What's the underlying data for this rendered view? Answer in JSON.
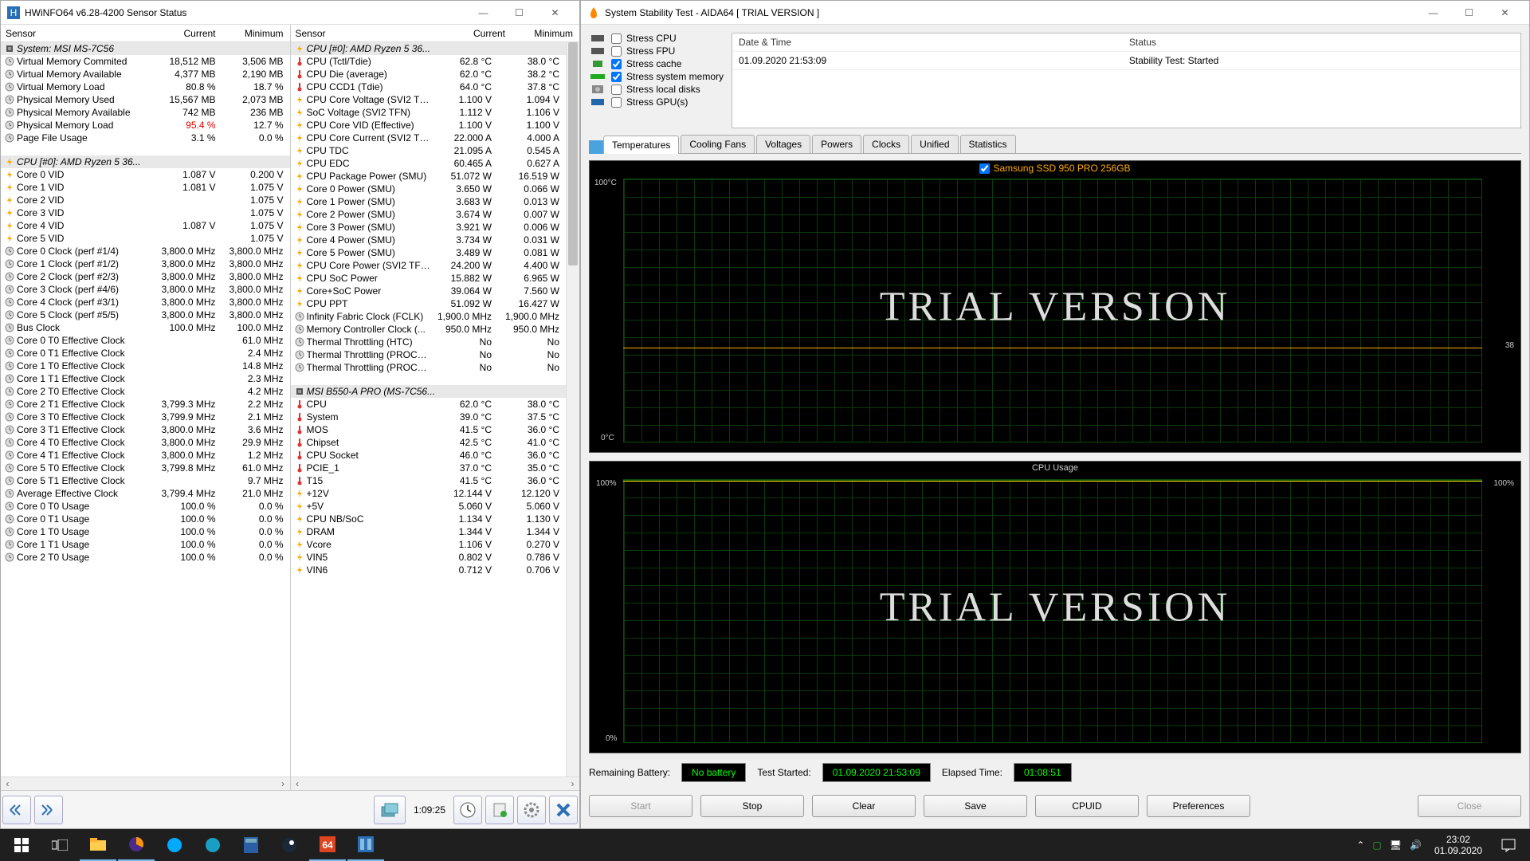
{
  "hwinfo": {
    "title": "HWiNFO64 v6.28-4200 Sensor Status",
    "columns": {
      "name": "Sensor",
      "current": "Current",
      "minimum": "Minimum"
    },
    "panel1_rows": [
      {
        "type": "group",
        "icon": "chip",
        "name": "System: MSI MS-7C56"
      },
      {
        "icon": "clock",
        "name": "Virtual Memory Commited",
        "cur": "18,512 MB",
        "min": "3,506 MB"
      },
      {
        "icon": "clock",
        "name": "Virtual Memory Available",
        "cur": "4,377 MB",
        "min": "2,190 MB"
      },
      {
        "icon": "clock",
        "name": "Virtual Memory Load",
        "cur": "80.8 %",
        "min": "18.7 %"
      },
      {
        "icon": "clock",
        "name": "Physical Memory Used",
        "cur": "15,567 MB",
        "min": "2,073 MB"
      },
      {
        "icon": "clock",
        "name": "Physical Memory Available",
        "cur": "742 MB",
        "min": "236 MB"
      },
      {
        "icon": "clock",
        "name": "Physical Memory Load",
        "cur": "95.4 %",
        "min": "12.7 %",
        "curclass": "red"
      },
      {
        "icon": "clock",
        "name": "Page File Usage",
        "cur": "3.1 %",
        "min": "0.0 %"
      },
      {
        "type": "spacer"
      },
      {
        "type": "group",
        "icon": "bolt",
        "name": "CPU [#0]: AMD Ryzen 5 36..."
      },
      {
        "icon": "bolt",
        "name": "Core 0 VID",
        "cur": "1.087 V",
        "min": "0.200 V"
      },
      {
        "icon": "bolt",
        "name": "Core 1 VID",
        "cur": "1.081 V",
        "min": "1.075 V"
      },
      {
        "icon": "bolt",
        "name": "Core 2 VID",
        "cur": "",
        "min": "1.075 V"
      },
      {
        "icon": "bolt",
        "name": "Core 3 VID",
        "cur": "",
        "min": "1.075 V"
      },
      {
        "icon": "bolt",
        "name": "Core 4 VID",
        "cur": "1.087 V",
        "min": "1.075 V"
      },
      {
        "icon": "bolt",
        "name": "Core 5 VID",
        "cur": "",
        "min": "1.075 V"
      },
      {
        "icon": "clock",
        "name": "Core 0 Clock (perf #1/4)",
        "cur": "3,800.0 MHz",
        "min": "3,800.0 MHz"
      },
      {
        "icon": "clock",
        "name": "Core 1 Clock (perf #1/2)",
        "cur": "3,800.0 MHz",
        "min": "3,800.0 MHz"
      },
      {
        "icon": "clock",
        "name": "Core 2 Clock (perf #2/3)",
        "cur": "3,800.0 MHz",
        "min": "3,800.0 MHz"
      },
      {
        "icon": "clock",
        "name": "Core 3 Clock (perf #4/6)",
        "cur": "3,800.0 MHz",
        "min": "3,800.0 MHz"
      },
      {
        "icon": "clock",
        "name": "Core 4 Clock (perf #3/1)",
        "cur": "3,800.0 MHz",
        "min": "3,800.0 MHz"
      },
      {
        "icon": "clock",
        "name": "Core 5 Clock (perf #5/5)",
        "cur": "3,800.0 MHz",
        "min": "3,800.0 MHz"
      },
      {
        "icon": "clock",
        "name": "Bus Clock",
        "cur": "100.0 MHz",
        "min": "100.0 MHz"
      },
      {
        "icon": "clock",
        "name": "Core 0 T0 Effective Clock",
        "cur": "",
        "min": "61.0 MHz"
      },
      {
        "icon": "clock",
        "name": "Core 0 T1 Effective Clock",
        "cur": "",
        "min": "2.4 MHz"
      },
      {
        "icon": "clock",
        "name": "Core 1 T0 Effective Clock",
        "cur": "",
        "min": "14.8 MHz"
      },
      {
        "icon": "clock",
        "name": "Core 1 T1 Effective Clock",
        "cur": "",
        "min": "2.3 MHz"
      },
      {
        "icon": "clock",
        "name": "Core 2 T0 Effective Clock",
        "cur": "",
        "min": "4.2 MHz"
      },
      {
        "icon": "clock",
        "name": "Core 2 T1 Effective Clock",
        "cur": "3,799.3 MHz",
        "min": "2.2 MHz"
      },
      {
        "icon": "clock",
        "name": "Core 3 T0 Effective Clock",
        "cur": "3,799.9 MHz",
        "min": "2.1 MHz"
      },
      {
        "icon": "clock",
        "name": "Core 3 T1 Effective Clock",
        "cur": "3,800.0 MHz",
        "min": "3.6 MHz"
      },
      {
        "icon": "clock",
        "name": "Core 4 T0 Effective Clock",
        "cur": "3,800.0 MHz",
        "min": "29.9 MHz"
      },
      {
        "icon": "clock",
        "name": "Core 4 T1 Effective Clock",
        "cur": "3,800.0 MHz",
        "min": "1.2 MHz"
      },
      {
        "icon": "clock",
        "name": "Core 5 T0 Effective Clock",
        "cur": "3,799.8 MHz",
        "min": "61.0 MHz"
      },
      {
        "icon": "clock",
        "name": "Core 5 T1 Effective Clock",
        "cur": "",
        "min": "9.7 MHz"
      },
      {
        "icon": "clock",
        "name": "Average Effective Clock",
        "cur": "3,799.4 MHz",
        "min": "21.0 MHz"
      },
      {
        "icon": "clock",
        "name": "Core 0 T0 Usage",
        "cur": "100.0 %",
        "min": "0.0 %"
      },
      {
        "icon": "clock",
        "name": "Core 0 T1 Usage",
        "cur": "100.0 %",
        "min": "0.0 %"
      },
      {
        "icon": "clock",
        "name": "Core 1 T0 Usage",
        "cur": "100.0 %",
        "min": "0.0 %"
      },
      {
        "icon": "clock",
        "name": "Core 1 T1 Usage",
        "cur": "100.0 %",
        "min": "0.0 %"
      },
      {
        "icon": "clock",
        "name": "Core 2 T0 Usage",
        "cur": "100.0 %",
        "min": "0.0 %"
      }
    ],
    "panel2_rows": [
      {
        "type": "group",
        "icon": "bolt",
        "name": "CPU [#0]: AMD Ryzen 5 36..."
      },
      {
        "icon": "therm",
        "name": "CPU (Tctl/Tdie)",
        "cur": "62.8 °C",
        "min": "38.0 °C"
      },
      {
        "icon": "therm",
        "name": "CPU Die (average)",
        "cur": "62.0 °C",
        "min": "38.2 °C"
      },
      {
        "icon": "therm",
        "name": "CPU CCD1 (Tdie)",
        "cur": "64.0 °C",
        "min": "37.8 °C"
      },
      {
        "icon": "bolt",
        "name": "CPU Core Voltage (SVI2 TF...",
        "cur": "1.100 V",
        "min": "1.094 V"
      },
      {
        "icon": "bolt",
        "name": "SoC Voltage (SVI2 TFN)",
        "cur": "1.112 V",
        "min": "1.106 V"
      },
      {
        "icon": "bolt",
        "name": "CPU Core VID (Effective)",
        "cur": "1.100 V",
        "min": "1.100 V"
      },
      {
        "icon": "bolt",
        "name": "CPU Core Current (SVI2 TF...",
        "cur": "22.000 A",
        "min": "4.000 A"
      },
      {
        "icon": "bolt",
        "name": "CPU TDC",
        "cur": "21.095 A",
        "min": "0.545 A"
      },
      {
        "icon": "bolt",
        "name": "CPU EDC",
        "cur": "60.465 A",
        "min": "0.627 A"
      },
      {
        "icon": "bolt",
        "name": "CPU Package Power (SMU)",
        "cur": "51.072 W",
        "min": "16.519 W"
      },
      {
        "icon": "bolt",
        "name": "Core 0 Power (SMU)",
        "cur": "3.650 W",
        "min": "0.066 W"
      },
      {
        "icon": "bolt",
        "name": "Core 1 Power (SMU)",
        "cur": "3.683 W",
        "min": "0.013 W"
      },
      {
        "icon": "bolt",
        "name": "Core 2 Power (SMU)",
        "cur": "3.674 W",
        "min": "0.007 W"
      },
      {
        "icon": "bolt",
        "name": "Core 3 Power (SMU)",
        "cur": "3.921 W",
        "min": "0.006 W"
      },
      {
        "icon": "bolt",
        "name": "Core 4 Power (SMU)",
        "cur": "3.734 W",
        "min": "0.031 W"
      },
      {
        "icon": "bolt",
        "name": "Core 5 Power (SMU)",
        "cur": "3.489 W",
        "min": "0.081 W"
      },
      {
        "icon": "bolt",
        "name": "CPU Core Power (SVI2 TFN)",
        "cur": "24.200 W",
        "min": "4.400 W"
      },
      {
        "icon": "bolt",
        "name": "CPU SoC Power",
        "cur": "15.882 W",
        "min": "6.965 W"
      },
      {
        "icon": "bolt",
        "name": "Core+SoC Power",
        "cur": "39.064 W",
        "min": "7.560 W"
      },
      {
        "icon": "bolt",
        "name": "CPU PPT",
        "cur": "51.092 W",
        "min": "16.427 W"
      },
      {
        "icon": "clock",
        "name": "Infinity Fabric Clock (FCLK)",
        "cur": "1,900.0 MHz",
        "min": "1,900.0 MHz"
      },
      {
        "icon": "clock",
        "name": "Memory Controller Clock (...",
        "cur": "950.0 MHz",
        "min": "950.0 MHz"
      },
      {
        "icon": "clock",
        "name": "Thermal Throttling (HTC)",
        "cur": "No",
        "min": "No"
      },
      {
        "icon": "clock",
        "name": "Thermal Throttling (PROCH...",
        "cur": "No",
        "min": "No"
      },
      {
        "icon": "clock",
        "name": "Thermal Throttling (PROCH...",
        "cur": "No",
        "min": "No"
      },
      {
        "type": "spacer"
      },
      {
        "type": "group",
        "icon": "chip",
        "name": "MSI B550-A PRO (MS-7C56..."
      },
      {
        "icon": "therm",
        "name": "CPU",
        "cur": "62.0 °C",
        "min": "38.0 °C"
      },
      {
        "icon": "therm",
        "name": "System",
        "cur": "39.0 °C",
        "min": "37.5 °C"
      },
      {
        "icon": "therm",
        "name": "MOS",
        "cur": "41.5 °C",
        "min": "36.0 °C"
      },
      {
        "icon": "therm",
        "name": "Chipset",
        "cur": "42.5 °C",
        "min": "41.0 °C"
      },
      {
        "icon": "therm",
        "name": "CPU Socket",
        "cur": "46.0 °C",
        "min": "36.0 °C"
      },
      {
        "icon": "therm",
        "name": "PCIE_1",
        "cur": "37.0 °C",
        "min": "35.0 °C"
      },
      {
        "icon": "therm",
        "name": "T15",
        "cur": "41.5 °C",
        "min": "36.0 °C"
      },
      {
        "icon": "bolt",
        "name": "+12V",
        "cur": "12.144 V",
        "min": "12.120 V"
      },
      {
        "icon": "bolt",
        "name": "+5V",
        "cur": "5.060 V",
        "min": "5.060 V"
      },
      {
        "icon": "bolt",
        "name": "CPU NB/SoC",
        "cur": "1.134 V",
        "min": "1.130 V"
      },
      {
        "icon": "bolt",
        "name": "DRAM",
        "cur": "1.344 V",
        "min": "1.344 V"
      },
      {
        "icon": "bolt",
        "name": "Vcore",
        "cur": "1.106 V",
        "min": "0.270 V"
      },
      {
        "icon": "bolt",
        "name": "VIN5",
        "cur": "0.802 V",
        "min": "0.786 V"
      },
      {
        "icon": "bolt",
        "name": "VIN6",
        "cur": "0.712 V",
        "min": "0.706 V"
      }
    ],
    "footer_time": "1:09:25"
  },
  "aida": {
    "title": "System Stability Test - AIDA64  [ TRIAL VERSION ]",
    "stress_items": [
      {
        "label": "Stress CPU",
        "checked": false
      },
      {
        "label": "Stress FPU",
        "checked": false
      },
      {
        "label": "Stress cache",
        "checked": true
      },
      {
        "label": "Stress system memory",
        "checked": true
      },
      {
        "label": "Stress local disks",
        "checked": false
      },
      {
        "label": "Stress GPU(s)",
        "checked": false
      }
    ],
    "status_header": {
      "dt": "Date & Time",
      "status": "Status"
    },
    "status_row": {
      "dt": "01.09.2020 21:53:09",
      "status": "Stability Test: Started"
    },
    "tabs": [
      "Temperatures",
      "Cooling Fans",
      "Voltages",
      "Powers",
      "Clocks",
      "Unified",
      "Statistics"
    ],
    "chart1": {
      "legend": "Samsung SSD 950 PRO 256GB",
      "ytop": "100°C",
      "ybot": "0°C",
      "marker": "38"
    },
    "chart2": {
      "title": "CPU Usage",
      "ytop": "100%",
      "ybot": "0%",
      "marker": "100%"
    },
    "watermark": "TRIAL VERSION",
    "status_bar": {
      "battery_label": "Remaining Battery:",
      "battery_val": "No battery",
      "started_label": "Test Started:",
      "started_val": "01.09.2020 21:53:09",
      "elapsed_label": "Elapsed Time:",
      "elapsed_val": "01:08:51"
    },
    "buttons": {
      "start": "Start",
      "stop": "Stop",
      "clear": "Clear",
      "save": "Save",
      "cpuid": "CPUID",
      "prefs": "Preferences",
      "close": "Close"
    }
  },
  "taskbar": {
    "time": "23:02",
    "date": "01.09.2020"
  },
  "chart_data": [
    {
      "type": "line",
      "title": "Temperature",
      "series": [
        {
          "name": "Samsung SSD 950 PRO 256GB",
          "values": [
            38
          ]
        }
      ],
      "ylim": [
        0,
        100
      ],
      "yunit": "°C"
    },
    {
      "type": "line",
      "title": "CPU Usage",
      "series": [
        {
          "name": "CPU Usage",
          "values": [
            100
          ]
        }
      ],
      "ylim": [
        0,
        100
      ],
      "yunit": "%"
    }
  ]
}
